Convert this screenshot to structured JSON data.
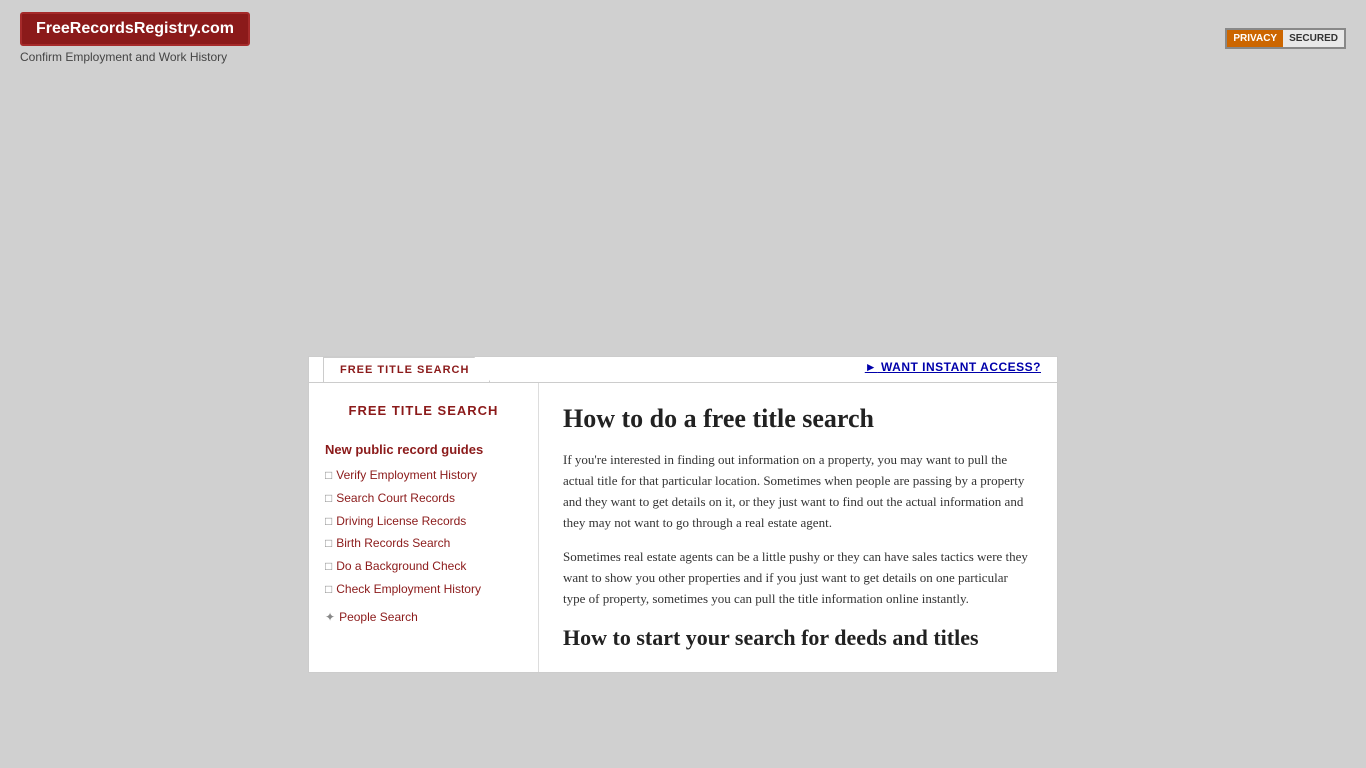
{
  "header": {
    "site_title": "FreeRecordsRegistry.com",
    "subtitle": "Confirm Employment and Work History",
    "privacy_left": "PRIVACY",
    "privacy_right": "SECURED"
  },
  "tab": {
    "label": "FREE TITLE SEARCH",
    "instant_access_label": "WANT INSTANT ACCESS?"
  },
  "sidebar": {
    "new_guides_title": "New public record guides",
    "links": [
      {
        "label": "Verify Employment History",
        "name": "verify-employment-history-link"
      },
      {
        "label": "Search Court Records",
        "name": "search-court-records-link"
      },
      {
        "label": "Driving License Records",
        "name": "driving-license-records-link"
      },
      {
        "label": "Birth Records Search",
        "name": "birth-records-search-link"
      },
      {
        "label": "Do a Background Check",
        "name": "background-check-link"
      },
      {
        "label": "Check Employment History",
        "name": "check-employment-history-link"
      }
    ],
    "people_search_label": "People Search"
  },
  "article": {
    "title": "How to do a free title search",
    "paragraph1": "If you're interested in finding out information on a property, you may want to pull the actual title for that particular location. Sometimes when people are passing by a property and they want to get details on it, or they just want to find out the actual information and they may not want to go through a real estate agent.",
    "paragraph2": "Sometimes real estate agents can be a little pushy or they can have sales tactics were they want to show you other properties and if you just want to get details on one particular type of property, sometimes you can pull the title information online instantly.",
    "section2_title": "How to start your search for deeds and titles"
  },
  "icons": {
    "doc_icon": "🗋",
    "crosshair_icon": "✤",
    "arrow_right": "►"
  }
}
